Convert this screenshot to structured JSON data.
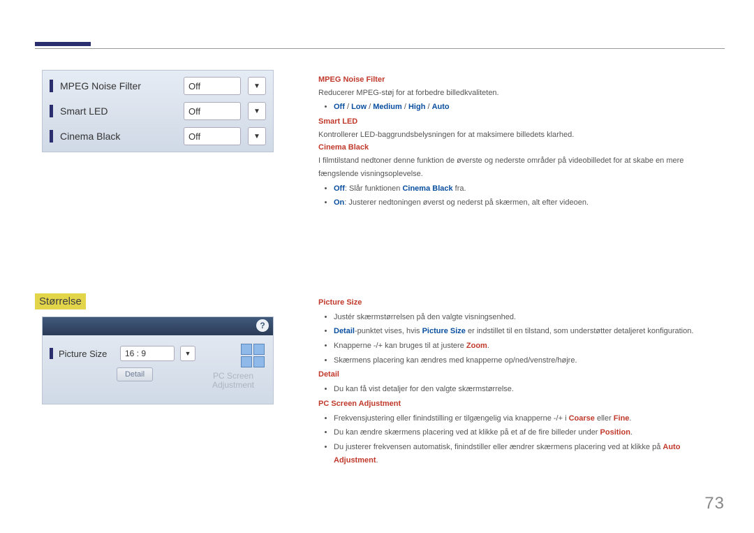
{
  "page_number": "73",
  "panel1": {
    "rows": [
      {
        "label": "MPEG Noise Filter",
        "value": "Off"
      },
      {
        "label": "Smart LED",
        "value": "Off"
      },
      {
        "label": "Cinema Black",
        "value": "Off"
      }
    ]
  },
  "section2_title": "Størrelse",
  "panel2": {
    "help_glyph": "?",
    "picsize_label": "Picture Size",
    "picsize_value": "16 : 9",
    "detail_btn": "Detail",
    "pc_screen_line1": "PC Screen",
    "pc_screen_line2": "Adjustment"
  },
  "right1": {
    "mpeg_hdr": "MPEG Noise Filter",
    "mpeg_body": "Reducerer MPEG-støj for at forbedre billedkvaliteten.",
    "mpeg_opts_parts": [
      "Off",
      " / ",
      "Low",
      " / ",
      "Medium",
      " / ",
      "High",
      " / ",
      "Auto"
    ],
    "smartled_hdr": "Smart LED",
    "smartled_body": "Kontrollerer LED-baggrundsbelysningen for at maksimere billedets klarhed.",
    "cb_hdr": "Cinema Black",
    "cb_body": "I filmtilstand nedtoner denne funktion de øverste og nederste områder på videobilledet for at skabe en mere fængslende visningsoplevelse.",
    "cb_off_pref": "Off",
    "cb_off_mid": ": Slår funktionen ",
    "cb_off_cb": "Cinema Black",
    "cb_off_suf": " fra.",
    "cb_on_pref": "On",
    "cb_on_suf": ": Justerer nedtoningen øverst og nederst på skærmen, alt efter videoen."
  },
  "right2": {
    "ps_hdr": "Picture Size",
    "ps_li1": "Justér skærmstørrelsen på den valgte visningsenhed.",
    "ps_li2_a": "Detail",
    "ps_li2_b": "-punktet vises, hvis ",
    "ps_li2_c": "Picture Size",
    "ps_li2_d": " er indstillet til en tilstand, som understøtter detaljeret konfiguration.",
    "ps_li3_a": "Knapperne -/+ kan bruges til at justere ",
    "ps_li3_b": "Zoom",
    "ps_li3_c": ".",
    "ps_li4": "Skærmens placering kan ændres med knapperne op/ned/venstre/højre.",
    "det_hdr": "Detail",
    "det_li1": "Du kan få vist detaljer for den valgte skærmstørrelse.",
    "psa_hdr": "PC Screen Adjustment",
    "psa_li1_a": "Frekvensjustering eller finindstilling er tilgængelig via knapperne -/+ i ",
    "psa_li1_b": "Coarse",
    "psa_li1_c": " eller ",
    "psa_li1_d": "Fine",
    "psa_li1_e": ".",
    "psa_li2_a": "Du kan ændre skærmens placering ved at klikke på et af de fire billeder under ",
    "psa_li2_b": "Position",
    "psa_li2_c": ".",
    "psa_li3_a": "Du justerer frekvensen automatisk, finindstiller eller ændrer skærmens placering ved at klikke på ",
    "psa_li3_b": "Auto Adjustment",
    "psa_li3_c": "."
  }
}
